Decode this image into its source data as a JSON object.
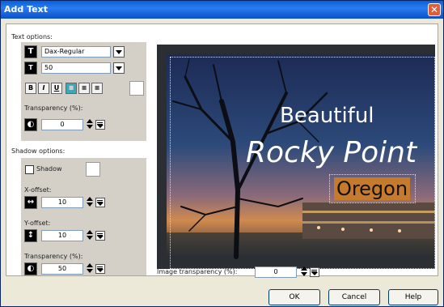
{
  "window": {
    "title": "Add Text",
    "close_label": "✕"
  },
  "text_options": {
    "label": "Text options:",
    "font": "Dax-Regular",
    "size": "50",
    "format_buttons": [
      "B",
      "I",
      "U",
      "≡",
      "≡",
      "≡"
    ],
    "transparency_label": "Transparency (%):",
    "transparency_value": "0"
  },
  "shadow_options": {
    "label": "Shadow options:",
    "shadow_label": "Shadow",
    "x_offset_label": "X-offset:",
    "x_offset_value": "10",
    "y_offset_label": "Y-offset:",
    "y_offset_value": "10",
    "transparency_label": "Transparency (%):",
    "transparency_value": "50"
  },
  "preview": {
    "line1": "Beautiful",
    "line2": "Rocky Point",
    "line3": "Oregon"
  },
  "image_transparency": {
    "label": "Image transparency (%):",
    "value": "0"
  },
  "buttons": {
    "ok": "OK",
    "cancel": "Cancel",
    "help": "Help"
  },
  "colors": {
    "title_bar": "#0a5fd8",
    "highlight_box": "#c57a2e",
    "active_button": "#3aa8b8"
  }
}
